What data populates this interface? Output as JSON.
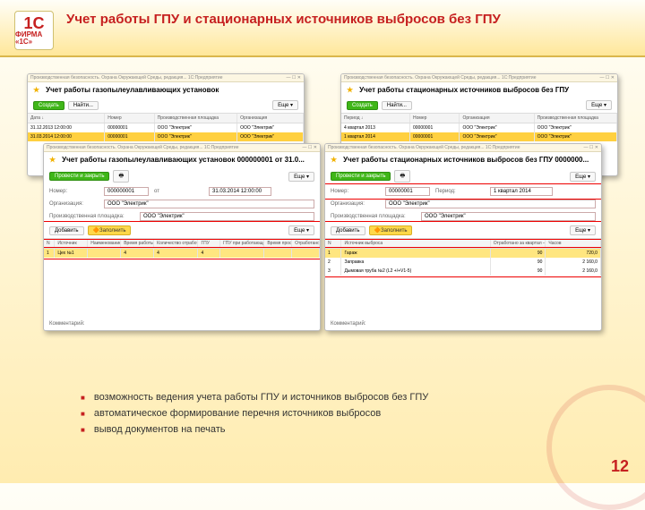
{
  "logo": {
    "top": "1С",
    "bottom": "ФИРМА «1С»"
  },
  "title": "Учет работы ГПУ и стационарных источников выбросов без ГПУ",
  "wins": {
    "titlebar_app": "Производственная безопасность. Охрана Окружающей Среды, редакция...  1С:Предприятие",
    "w1": {
      "title": "Учет работы газопылеулавливающих установок",
      "create": "Создать",
      "find": "Найти...",
      "more": "Еще ▾",
      "headers": [
        "Дата",
        "Номер",
        "Производственная площадка",
        "Организация"
      ],
      "rows": [
        [
          "31.12.2013 12:00:00",
          "00000001",
          "ООО \"Электрик\"",
          "ООО \"Электрик\""
        ],
        [
          "31.03.2014 12:00:00",
          "00000001",
          "ООО \"Электрик\"",
          "ООО \"Электрик\""
        ]
      ]
    },
    "w2": {
      "title": "Учет работы стационарных источников выбросов без ГПУ",
      "create": "Создать",
      "find": "Найти...",
      "more": "Еще ▾",
      "headers": [
        "Период",
        "Номер",
        "Организация",
        "Производственная площадка"
      ],
      "rows": [
        [
          "4 квартал 2013",
          "00000001",
          "ООО \"Электрик\"",
          "ООО \"Электрик\""
        ],
        [
          "1 квартал 2014",
          "00000001",
          "ООО \"Электрик\"",
          "ООО \"Электрик\""
        ]
      ]
    },
    "w3": {
      "title": "Учет работы газопылеулавливающих установок 000000001 от 31.0...",
      "post_close": "Провести и закрыть",
      "more": "Еще ▾",
      "form": {
        "number_l": "Номер:",
        "number": "000000001",
        "at_l": "от",
        "at": "31.03.2014 12:00:00",
        "org_l": "Организация:",
        "org": "ООО \"Электрик\"",
        "site_l": "Производственная площадка:",
        "site": "ООО \"Электрик\"",
        "add": "Добавить",
        "fill": "Заполнить"
      },
      "headers": [
        "N",
        "Источник",
        "Наименование",
        "Время работы в сутки",
        "Количество отработанных часов",
        "ГПУ",
        "ГПУ при работающем оборудовании",
        "Время простоя",
        "Отработано"
      ],
      "row": [
        "1",
        "Цех №1",
        "",
        "4",
        "4",
        "4",
        "",
        "",
        ""
      ],
      "comment_l": "Комментарий:"
    },
    "w4": {
      "title": "Учет работы стационарных источников выбросов без ГПУ 0000000...",
      "post_close": "Провести и закрыть",
      "more": "Еще ▾",
      "form": {
        "number_l": "Номер:",
        "number": "00000001",
        "period_l": "Период:",
        "period": "1 квартал 2014",
        "org_l": "Организация:",
        "org": "ООО \"Электрик\"",
        "site_l": "Производственная площадка:",
        "site": "ООО \"Электрик\"",
        "add": "Добавить",
        "fill": "Заполнить"
      },
      "headers": [
        "N",
        "Источник выброса",
        "Отработано за квартал — Дней",
        "Часов"
      ],
      "rows": [
        [
          "1",
          "Гараж",
          "90",
          "720,0"
        ],
        [
          "2",
          "Заправка",
          "90",
          "2 160,0"
        ],
        [
          "3",
          "Дымовая труба №2 (L2 +/+V1-5)",
          "90",
          "2 160,0"
        ]
      ],
      "comment_l": "Комментарий:"
    }
  },
  "bullets": [
    "возможность ведения учета работы ГПУ и источников выбросов без ГПУ",
    "автоматическое формирование перечня источников выбросов",
    "вывод документов на печать"
  ],
  "page": "12"
}
